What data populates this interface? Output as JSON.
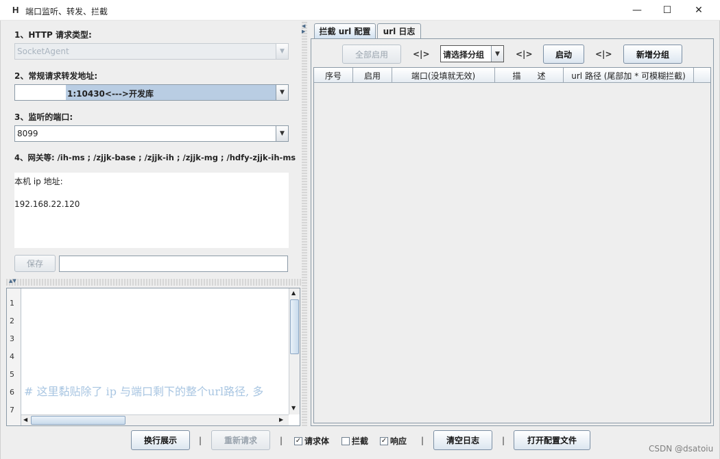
{
  "window": {
    "icon_letter": "H",
    "title": "端口监听、转发、拦截",
    "minimize": "—",
    "maximize": "☐",
    "close": "✕"
  },
  "left": {
    "q1_label": "1、HTTP 请求类型:",
    "q1_value": "SocketAgent",
    "q2_label": "2、常规请求转发地址:",
    "q2_value": "1:10430<--->开发库",
    "q3_label": "3、监听的端口:",
    "q3_value": "8099",
    "q4_label": "4、网关等: /ih-ms ; /zjjk-base ; /zjjk-ih ; /zjjk-mg ; /hdfy-zjjk-ih-ms",
    "info_line1": "本机 ip 地址:",
    "info_line2": "192.168.22.120",
    "save_label": "保存",
    "save_input_value": ""
  },
  "editor": {
    "line_numbers": [
      "1",
      "2",
      "3",
      "4",
      "5",
      "6",
      "7"
    ],
    "placeholder": "# 这里黏贴除了 ip 与端口剩下的整个url路径, 多"
  },
  "right": {
    "tabs": [
      {
        "label": "拦截 url 配置"
      },
      {
        "label": "url 日志"
      }
    ],
    "enable_all": "全部启用",
    "sep1": "<|>",
    "group_select": "请选择分组",
    "sep2": "<|>",
    "start": "启动",
    "sep3": "<|>",
    "add_group": "新增分组",
    "columns": [
      "序号",
      "启用",
      "端口(没填就无效)",
      "描　　述",
      "url 路径 (尾部加 * 可模糊拦截)"
    ]
  },
  "bottom": {
    "wrap": "换行展示",
    "sep": "|",
    "resend": "重新请求",
    "req_body": "请求体",
    "req_body_checked": true,
    "intercept": "拦截",
    "intercept_checked": false,
    "response": "响应",
    "response_checked": true,
    "clear_log": "清空日志",
    "open_config": "打开配置文件",
    "check_mark": "✓"
  },
  "watermark": "CSDN @dsatoiu"
}
